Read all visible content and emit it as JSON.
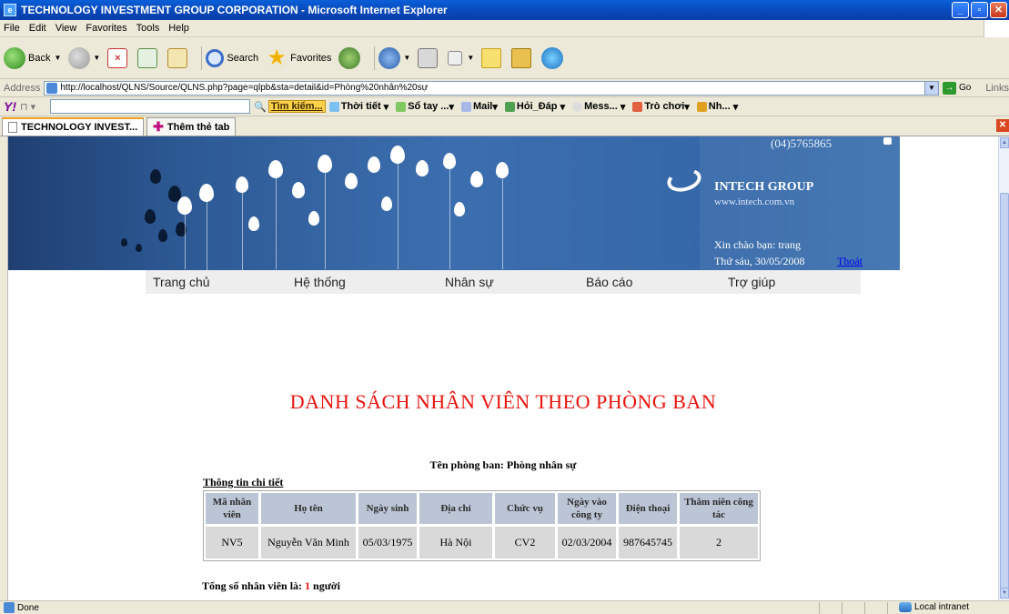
{
  "window": {
    "title": "TECHNOLOGY INVESTMENT GROUP CORPORATION - Microsoft Internet Explorer"
  },
  "menu": [
    "File",
    "Edit",
    "View",
    "Favorites",
    "Tools",
    "Help"
  ],
  "toolbar": {
    "back": "Back",
    "search": "Search",
    "favorites": "Favorites"
  },
  "address": {
    "label": "Address",
    "url": "http://localhost/QLNS/Source/QLNS.php?page=qlpb&sta=detail&id=Phòng%20nhân%20sự",
    "go": "Go",
    "links": "Links"
  },
  "yahoo_bar": {
    "search_button": "Tìm kiếm...",
    "items": [
      "Thời tiết",
      "Sổ tay ...",
      "Mail",
      "Hỏi_Đáp",
      "Mess...",
      "Trò chơi",
      "Nh..."
    ]
  },
  "tabs": [
    "TECHNOLOGY INVEST...",
    "Thêm thẻ tab"
  ],
  "banner": {
    "phone": "(04)5765865",
    "company": "INTECH GROUP",
    "website": "www.intech.com.vn",
    "greeting": "Xin chào bạn: trang",
    "date": "Thứ sáu, 30/05/2008",
    "logout": "Thoát"
  },
  "nav": [
    "Trang chủ",
    "Hệ thống",
    "Nhân sự",
    "Báo cáo",
    "Trợ giúp"
  ],
  "page": {
    "heading": "DANH SÁCH NHÂN VIÊN THEO PHÒNG BAN",
    "department_label": "Tên phòng ban: Phòng nhân sự",
    "detail_link": "Thông tin chi tiết",
    "total_prefix": "Tổng số nhân viên là: ",
    "total_count": "1",
    "total_suffix": " người"
  },
  "table": {
    "headers": [
      "Mã nhân viên",
      "Họ tên",
      "Ngày sinh",
      "Địa chỉ",
      "Chức vụ",
      "Ngày vào công ty",
      "Điện thoại",
      "Thâm niên công tác"
    ],
    "rows": [
      [
        "NV5",
        "Nguyễn Văn Minh",
        "05/03/1975",
        "Hà Nội",
        "CV2",
        "02/03/2004",
        "987645745",
        "2"
      ]
    ]
  },
  "status": {
    "left": "Done",
    "zone": "Local intranet"
  }
}
